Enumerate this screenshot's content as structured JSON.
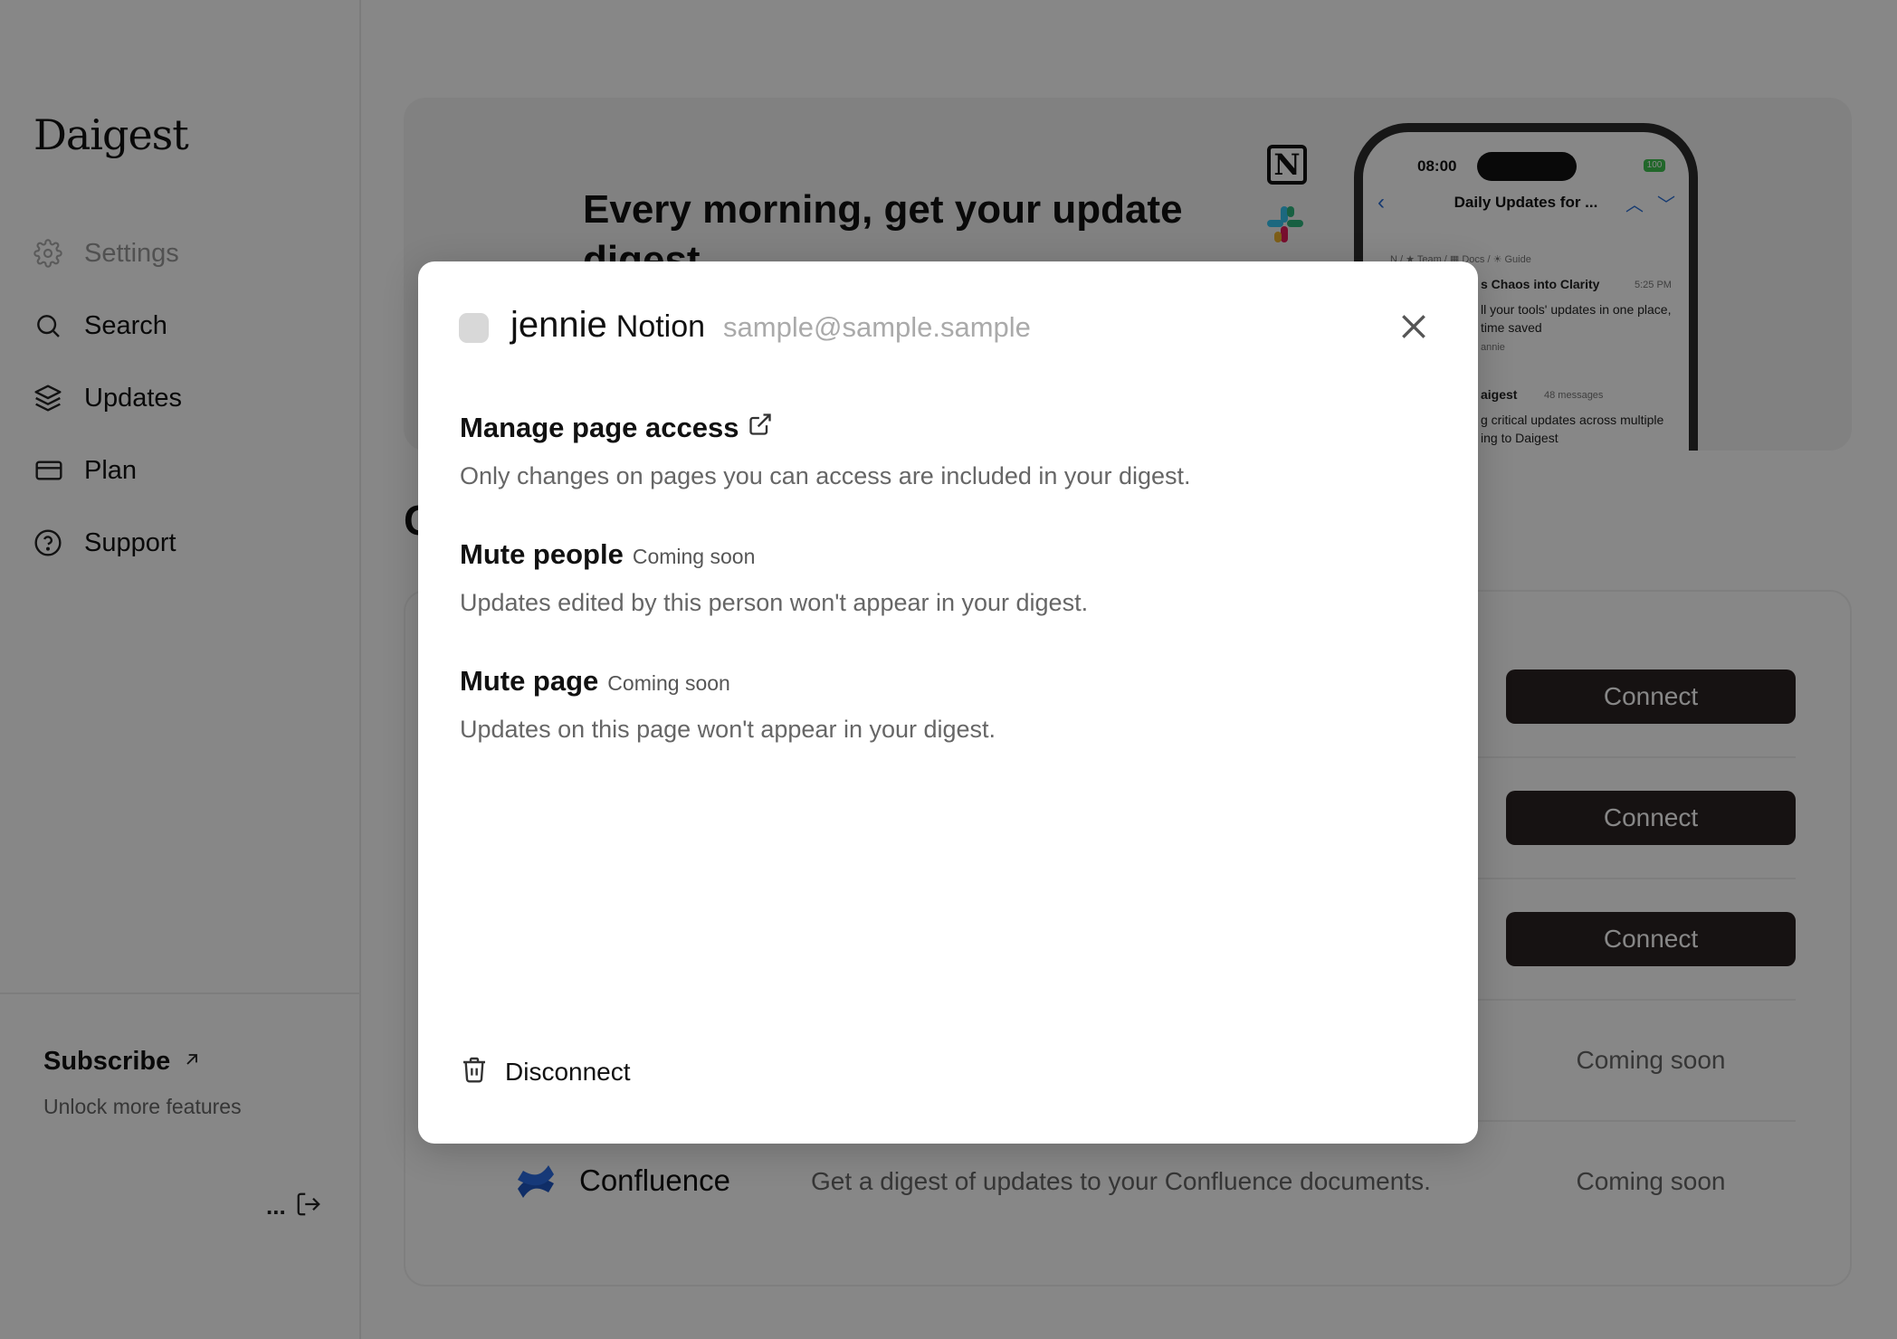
{
  "app": {
    "logo": "Daigest"
  },
  "sidebar": {
    "items": [
      {
        "label": "Settings",
        "icon": "gear-icon"
      },
      {
        "label": "Search",
        "icon": "search-icon"
      },
      {
        "label": "Updates",
        "icon": "layers-icon"
      },
      {
        "label": "Plan",
        "icon": "credit-card-icon"
      },
      {
        "label": "Support",
        "icon": "help-circle-icon"
      }
    ],
    "subscribe": {
      "label": "Subscribe",
      "subtitle": "Unlock more features"
    },
    "account": {
      "dots": "..."
    }
  },
  "hero": {
    "title": "Every morning, get your update digest",
    "phone": {
      "time": "08:00",
      "battery": "100",
      "header": "Daily Updates for ...",
      "breadcrumb": "N / ★ Team / ▦ Docs / ☀ Guide",
      "item1_title": "s Chaos into Clarity",
      "item1_time": "5:25 PM",
      "item1_line1": "ll your tools' updates in one place,",
      "item1_line2": "time saved",
      "item1_user": "annie",
      "item2_title": "aigest",
      "item2_meta": "48 messages",
      "item2_line1": "g critical updates across multiple",
      "item2_line2": "ing to Daigest"
    }
  },
  "main": {
    "section_partial": "C",
    "connect_label": "Connect",
    "coming_soon_label": "Coming soon",
    "confluence": {
      "name": "Confluence",
      "description": "Get a digest of updates to your Confluence documents.",
      "status": "Coming soon"
    }
  },
  "modal": {
    "user_name": "jennie",
    "tool": "Notion",
    "email": "sample@sample.sample",
    "sections": [
      {
        "title": "Manage page access",
        "badge": "",
        "description": "Only changes on pages you can access are included in your digest."
      },
      {
        "title": "Mute people",
        "badge": "Coming soon",
        "description": "Updates edited by this person won't appear in your digest."
      },
      {
        "title": "Mute page",
        "badge": "Coming soon",
        "description": "Updates on this page won't appear in your digest."
      }
    ],
    "disconnect_label": "Disconnect"
  },
  "colors": {
    "overlay": "#00000078",
    "button_dark": "#2a2222",
    "confluence_blue": "#1f57c3"
  }
}
